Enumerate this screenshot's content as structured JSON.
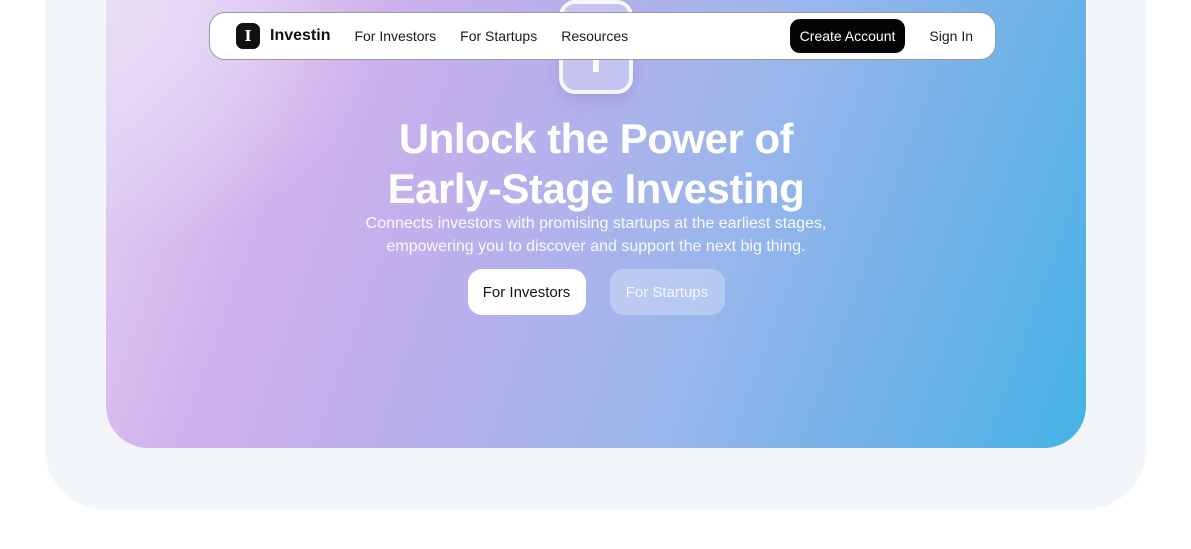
{
  "nav": {
    "brand_initial": "I",
    "brand_name": "Investin",
    "links": [
      "For Investors",
      "For Startups",
      "Resources"
    ],
    "create_account_label": "Create Account",
    "sign_in_label": "Sign In"
  },
  "hero": {
    "logo_glyph": "I",
    "headline_line1": "Unlock the Power of",
    "headline_line2": "Early-Stage Investing",
    "subtext_line1": "Connects investors with promising startups at the earliest stages,",
    "subtext_line2": "empowering you to discover and support the next big thing.",
    "primary_cta": "For Investors",
    "secondary_cta": "For Startups"
  },
  "colors": {
    "accent_dark": "#050505",
    "gradient_start": "#e4d6f3",
    "gradient_mid": "#b8b0ec",
    "gradient_end": "#45b3e6",
    "page_background": "#f2f5fa"
  }
}
